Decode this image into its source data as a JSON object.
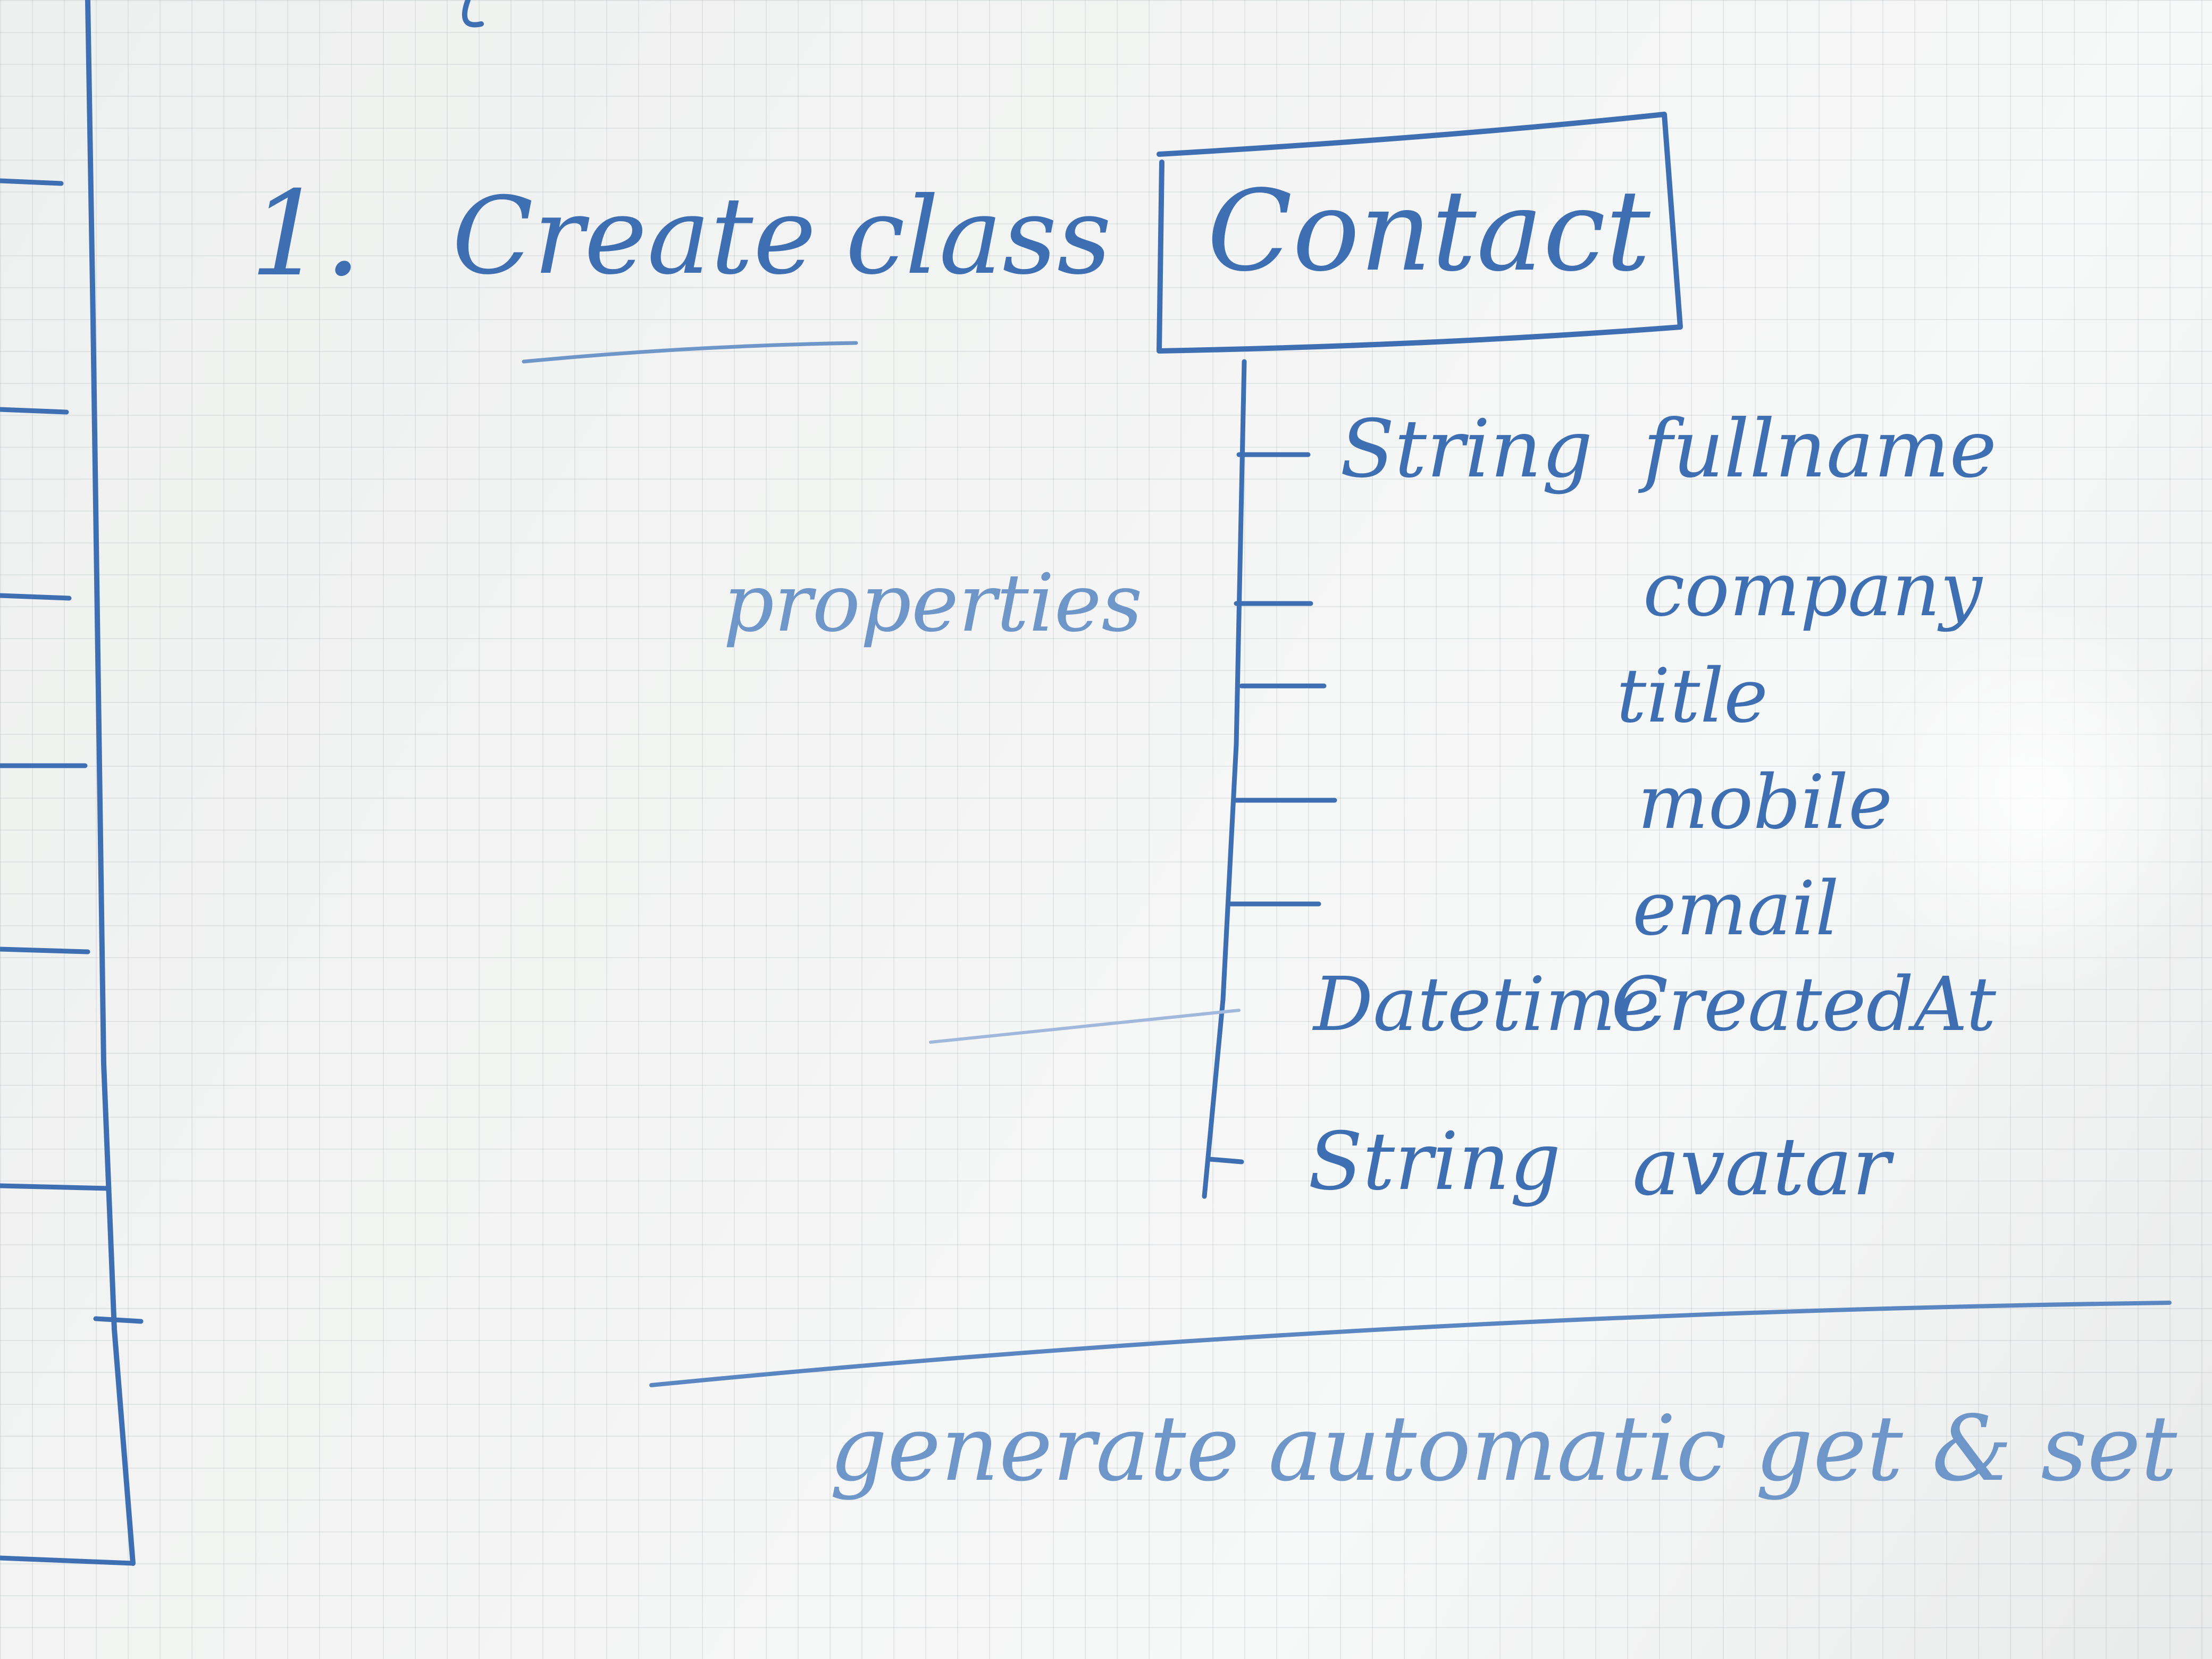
{
  "board": {
    "step": "1.",
    "heading_create": "Create",
    "heading_class": "class",
    "class_name": "Contact",
    "properties_label": "properties",
    "properties": [
      {
        "type": "String",
        "name": "fullname"
      },
      {
        "type": "",
        "name": "company"
      },
      {
        "type": "",
        "name": "title"
      },
      {
        "type": "",
        "name": "mobile"
      },
      {
        "type": "",
        "name": "email"
      },
      {
        "type": "Datetime",
        "name": "CreatedAt"
      },
      {
        "type": "String",
        "name": "avatar"
      }
    ],
    "footer_note": "generate automatic get & set"
  },
  "colors": {
    "ink": "#3f6fb3",
    "ink_light": "#6f96c9",
    "board": "#f3f4f3"
  }
}
